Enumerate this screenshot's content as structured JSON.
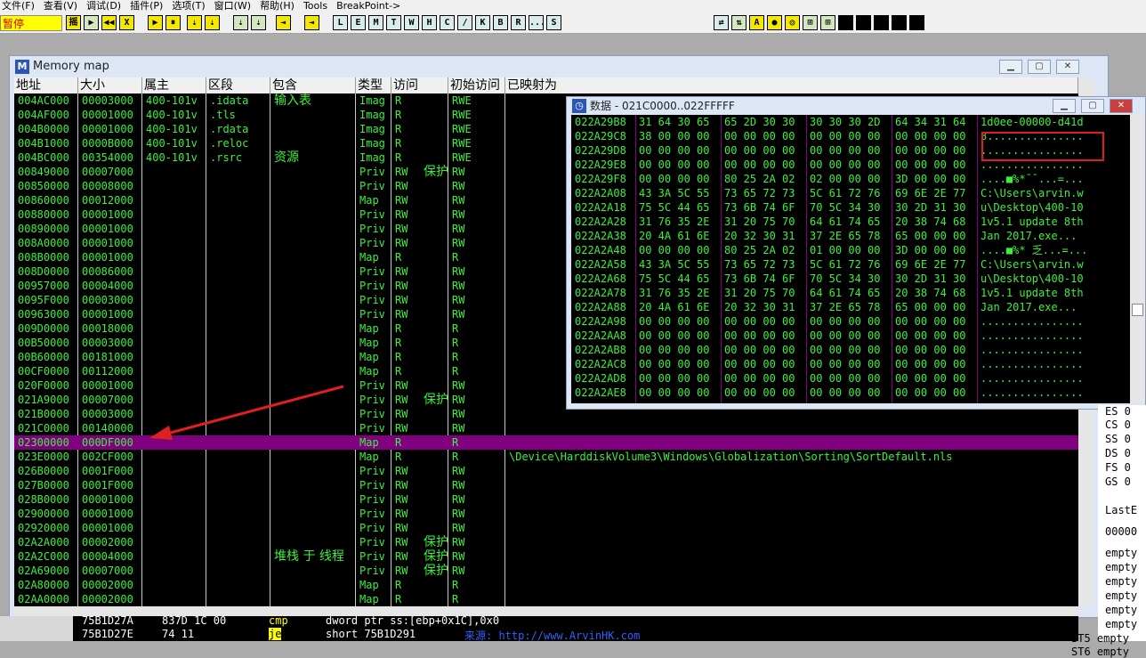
{
  "menu": [
    "文件(F)",
    "查看(V)",
    "调试(D)",
    "插件(P)",
    "选项(T)",
    "窗口(W)",
    "帮助(H)",
    "Tools",
    "BreakPoint->"
  ],
  "toolbar": {
    "status": "暂停",
    "buttons": [
      "摇",
      "▶",
      "◀◀",
      "X",
      "▶",
      "⏸",
      "⇣",
      "⇣",
      "⇣",
      "⇣",
      "⇥",
      "⇥",
      "L",
      "E",
      "M",
      "T",
      "W",
      "H",
      "C",
      "/",
      "K",
      "B",
      "R",
      "...",
      "S"
    ],
    "right_buttons": [
      "⇄",
      "⇅",
      "A",
      "●",
      "◎",
      "⊞",
      "⊞"
    ]
  },
  "memory_map": {
    "title": "Memory map",
    "icon": "M",
    "columns": [
      "地址",
      "大小",
      "属主",
      "区段",
      "包含",
      "类型",
      "访问",
      "初始访问",
      "已映射为"
    ],
    "rows": [
      [
        "004AC000",
        "00003000",
        "400-101v",
        ".idata",
        "输入表",
        "Imag",
        "R",
        "",
        "RWE",
        ""
      ],
      [
        "004AF000",
        "00001000",
        "400-101v",
        ".tls",
        "",
        "Imag",
        "R",
        "",
        "RWE",
        ""
      ],
      [
        "004B0000",
        "00001000",
        "400-101v",
        ".rdata",
        "",
        "Imag",
        "R",
        "",
        "RWE",
        ""
      ],
      [
        "004B1000",
        "0000B000",
        "400-101v",
        ".reloc",
        "",
        "Imag",
        "R",
        "",
        "RWE",
        ""
      ],
      [
        "004BC000",
        "00354000",
        "400-101v",
        ".rsrc",
        "资源",
        "Imag",
        "R",
        "",
        "RWE",
        ""
      ],
      [
        "00849000",
        "00007000",
        "",
        "",
        "",
        "Priv",
        "RW",
        "保护",
        "RW",
        ""
      ],
      [
        "00850000",
        "00008000",
        "",
        "",
        "",
        "Priv",
        "RW",
        "",
        "RW",
        ""
      ],
      [
        "00860000",
        "00012000",
        "",
        "",
        "",
        "Map",
        "RW",
        "",
        "RW",
        ""
      ],
      [
        "00880000",
        "00001000",
        "",
        "",
        "",
        "Priv",
        "RW",
        "",
        "RW",
        ""
      ],
      [
        "00890000",
        "00001000",
        "",
        "",
        "",
        "Priv",
        "RW",
        "",
        "RW",
        ""
      ],
      [
        "008A0000",
        "00001000",
        "",
        "",
        "",
        "Priv",
        "RW",
        "",
        "RW",
        ""
      ],
      [
        "008B0000",
        "00001000",
        "",
        "",
        "",
        "Map",
        "R",
        "",
        "R",
        ""
      ],
      [
        "008D0000",
        "00086000",
        "",
        "",
        "",
        "Priv",
        "RW",
        "",
        "RW",
        ""
      ],
      [
        "00957000",
        "00004000",
        "",
        "",
        "",
        "Priv",
        "RW",
        "",
        "RW",
        ""
      ],
      [
        "0095F000",
        "00003000",
        "",
        "",
        "",
        "Priv",
        "RW",
        "",
        "RW",
        ""
      ],
      [
        "00963000",
        "00001000",
        "",
        "",
        "",
        "Priv",
        "RW",
        "",
        "RW",
        ""
      ],
      [
        "009D0000",
        "00018000",
        "",
        "",
        "",
        "Map",
        "R",
        "",
        "R",
        ""
      ],
      [
        "00B50000",
        "00003000",
        "",
        "",
        "",
        "Map",
        "R",
        "",
        "R",
        ""
      ],
      [
        "00B60000",
        "00181000",
        "",
        "",
        "",
        "Map",
        "R",
        "",
        "R",
        ""
      ],
      [
        "00CF0000",
        "00112000",
        "",
        "",
        "",
        "Map",
        "R",
        "",
        "R",
        ""
      ],
      [
        "020F0000",
        "00001000",
        "",
        "",
        "",
        "Priv",
        "RW",
        "",
        "RW",
        ""
      ],
      [
        "021A9000",
        "00007000",
        "",
        "",
        "",
        "Priv",
        "RW",
        "保护",
        "RW",
        ""
      ],
      [
        "021B0000",
        "00003000",
        "",
        "",
        "",
        "Priv",
        "RW",
        "",
        "RW",
        ""
      ],
      [
        "021C0000",
        "00140000",
        "",
        "",
        "",
        "Priv",
        "RW",
        "",
        "RW",
        ""
      ],
      [
        "02300000",
        "000DF000",
        "",
        "",
        "",
        "Map",
        "R",
        "",
        "R",
        ""
      ],
      [
        "023E0000",
        "002CF000",
        "",
        "",
        "",
        "Map",
        "R",
        "",
        "R",
        "\\Device\\HarddiskVolume3\\Windows\\Globalization\\Sorting\\SortDefault.nls"
      ],
      [
        "026B0000",
        "0001F000",
        "",
        "",
        "",
        "Priv",
        "RW",
        "",
        "RW",
        ""
      ],
      [
        "027B0000",
        "0001F000",
        "",
        "",
        "",
        "Priv",
        "RW",
        "",
        "RW",
        ""
      ],
      [
        "028B0000",
        "00001000",
        "",
        "",
        "",
        "Priv",
        "RW",
        "",
        "RW",
        ""
      ],
      [
        "02900000",
        "00001000",
        "",
        "",
        "",
        "Priv",
        "RW",
        "",
        "RW",
        ""
      ],
      [
        "02920000",
        "00001000",
        "",
        "",
        "",
        "Priv",
        "RW",
        "",
        "RW",
        ""
      ],
      [
        "02A2A000",
        "00002000",
        "",
        "",
        "",
        "Priv",
        "RW",
        "保护",
        "RW",
        ""
      ],
      [
        "02A2C000",
        "00004000",
        "",
        "",
        "堆栈 于  线程",
        "Priv",
        "RW",
        "保护",
        "RW",
        ""
      ],
      [
        "02A69000",
        "00007000",
        "",
        "",
        "",
        "Priv",
        "RW",
        "保护",
        "RW",
        ""
      ],
      [
        "02A80000",
        "00002000",
        "",
        "",
        "",
        "Map",
        "R",
        "",
        "R",
        ""
      ],
      [
        "02AA0000",
        "00002000",
        "",
        "",
        "",
        "Map",
        "R",
        "",
        "R",
        ""
      ]
    ],
    "selected_row": 24
  },
  "data_window": {
    "title": "数据 - 021C0000..022FFFFF",
    "rows": [
      [
        "022A29B8",
        "31 64 30 65",
        "65 2D 30 30",
        "30 30 30 2D",
        "64 34 31 64",
        "1d0ee-00000-d41d"
      ],
      [
        "022A29C8",
        "38 00 00 00",
        "00 00 00 00",
        "00 00 00 00",
        "00 00 00 00",
        "8..............."
      ],
      [
        "022A29D8",
        "00 00 00 00",
        "00 00 00 00",
        "00 00 00 00",
        "00 00 00 00",
        "................"
      ],
      [
        "022A29E8",
        "00 00 00 00",
        "00 00 00 00",
        "00 00 00 00",
        "00 00 00 00",
        "................"
      ],
      [
        "022A29F8",
        "00 00 00 00",
        "80 25 2A 02",
        "02 00 00 00",
        "3D 00 00 00",
        "....■%*¯¯...=..."
      ],
      [
        "022A2A08",
        "43 3A 5C 55",
        "73 65 72 73",
        "5C 61 72 76",
        "69 6E 2E 77",
        "C:\\Users\\arvin.w"
      ],
      [
        "022A2A18",
        "75 5C 44 65",
        "73 6B 74 6F",
        "70 5C 34 30",
        "30 2D 31 30",
        "u\\Desktop\\400-10"
      ],
      [
        "022A2A28",
        "31 76 35 2E",
        "31 20 75 70",
        "64 61 74 65",
        "20 38 74 68",
        "1v5.1 update 8th"
      ],
      [
        "022A2A38",
        "20 4A 61 6E",
        "20 32 30 31",
        "37 2E 65 78",
        "65 00 00 00",
        " Jan 2017.exe..."
      ],
      [
        "022A2A48",
        "00 00 00 00",
        "80 25 2A 02",
        "01 00 00 00",
        "3D 00 00 00",
        "....■%* 乏...=..."
      ],
      [
        "022A2A58",
        "43 3A 5C 55",
        "73 65 72 73",
        "5C 61 72 76",
        "69 6E 2E 77",
        "C:\\Users\\arvin.w"
      ],
      [
        "022A2A68",
        "75 5C 44 65",
        "73 6B 74 6F",
        "70 5C 34 30",
        "30 2D 31 30",
        "u\\Desktop\\400-10"
      ],
      [
        "022A2A78",
        "31 76 35 2E",
        "31 20 75 70",
        "64 61 74 65",
        "20 38 74 68",
        "1v5.1 update 8th"
      ],
      [
        "022A2A88",
        "20 4A 61 6E",
        "20 32 30 31",
        "37 2E 65 78",
        "65 00 00 00",
        " Jan 2017.exe..."
      ],
      [
        "022A2A98",
        "00 00 00 00",
        "00 00 00 00",
        "00 00 00 00",
        "00 00 00 00",
        "................"
      ],
      [
        "022A2AA8",
        "00 00 00 00",
        "00 00 00 00",
        "00 00 00 00",
        "00 00 00 00",
        "................"
      ],
      [
        "022A2AB8",
        "00 00 00 00",
        "00 00 00 00",
        "00 00 00 00",
        "00 00 00 00",
        "................"
      ],
      [
        "022A2AC8",
        "00 00 00 00",
        "00 00 00 00",
        "00 00 00 00",
        "00 00 00 00",
        "................"
      ],
      [
        "022A2AD8",
        "00 00 00 00",
        "00 00 00 00",
        "00 00 00 00",
        "00 00 00 00",
        "................"
      ],
      [
        "022A2AE8",
        "00 00 00 00",
        "00 00 00 00",
        "00 00 00 00",
        "00 00 00 00",
        "................"
      ]
    ]
  },
  "registers": [
    "ES 0",
    "CS 0",
    "SS 0",
    "DS 0",
    "FS 0",
    "GS 0",
    "LastE",
    "00000",
    "empty",
    "empty",
    "empty",
    "empty",
    "empty",
    "empty",
    "ST5 empty",
    "ST6 empty"
  ],
  "cpu_strip": {
    "line1": {
      "addr": "75B1D27A",
      "bytes": "837D 1C 00",
      "mnemonic": "cmp",
      "operand": "dword ptr ss:[ebp+0x1C],0x0"
    },
    "line2": {
      "addr": "75B1D27E",
      "bytes": "74 11",
      "mnemonic": "je",
      "operand": "short 75B1D291"
    },
    "watermark": "来源: http://www.ArvinHK.com"
  },
  "colors": {
    "text_green": "#3cf03c",
    "selected_row": "#800080",
    "arrow_red": "#e02020"
  }
}
